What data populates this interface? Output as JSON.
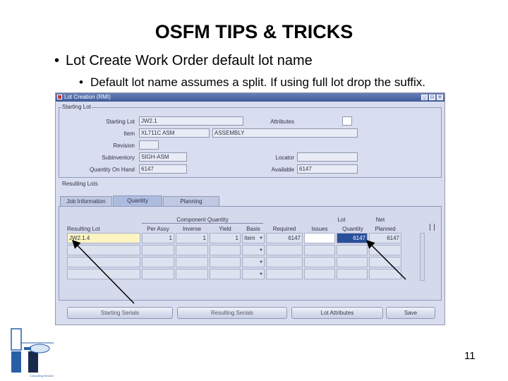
{
  "slide": {
    "title": "OSFM TIPS & TRICKS",
    "bullet1": "Lot Create Work Order default lot name",
    "bullet2": "Default lot name assumes a split.  If using full lot drop the suffix.",
    "page_number": "11"
  },
  "window": {
    "title": "Lot Creation (RMI)",
    "starting_lot": {
      "group_label": "Starting Lot",
      "labels": {
        "starting_lot": "Starting Lot",
        "item": "Item",
        "revision": "Revision",
        "subinventory": "Subinventory",
        "quantity_on_hand": "Quantity On Hand",
        "attributes": "Attributes",
        "locator": "Locator",
        "available": "Available"
      },
      "values": {
        "starting_lot": "JW2.1",
        "item": "XL711C ASM",
        "item_desc": "ASSEMBLY",
        "revision": "",
        "subinventory": "SIGH-ASM",
        "quantity_on_hand": "6147",
        "attributes": "",
        "locator": "",
        "available": "6147"
      }
    },
    "resulting_lots": {
      "group_label": "Resulting Lots",
      "tabs": [
        "Job Information",
        "Quantity",
        "Planning"
      ],
      "active_tab": "Quantity",
      "group_header": "Component Quantity",
      "columns": [
        "Resulting Lot",
        "Per Assy",
        "Inverse",
        "Yield",
        "Basis",
        "Required",
        "Issues",
        "Lot Quantity",
        "Net Planned"
      ],
      "column_top_labels": {
        "lot_quantity": "Lot",
        "net_planned": "Net"
      },
      "column_bottom_labels": {
        "lot_quantity": "Quantity",
        "net_planned": "Planned"
      },
      "rows": [
        {
          "lot": "JW2.1.4",
          "per_assy": "1",
          "inverse": "1",
          "yield": "1",
          "basis": "Item",
          "required": "6147",
          "issues": "",
          "lot_qty": "6147",
          "net_planned": "6147"
        },
        {
          "lot": "",
          "per_assy": "",
          "inverse": "",
          "yield": "",
          "basis": "",
          "required": "",
          "issues": "",
          "lot_qty": "",
          "net_planned": ""
        },
        {
          "lot": "",
          "per_assy": "",
          "inverse": "",
          "yield": "",
          "basis": "",
          "required": "",
          "issues": "",
          "lot_qty": "",
          "net_planned": ""
        },
        {
          "lot": "",
          "per_assy": "",
          "inverse": "",
          "yield": "",
          "basis": "",
          "required": "",
          "issues": "",
          "lot_qty": "",
          "net_planned": ""
        }
      ]
    },
    "buttons": {
      "starting_serials": "Starting Serials",
      "resulting_serials": "Resulting Serials",
      "lot_attributes": "Lot Attributes",
      "save": "Save"
    }
  }
}
